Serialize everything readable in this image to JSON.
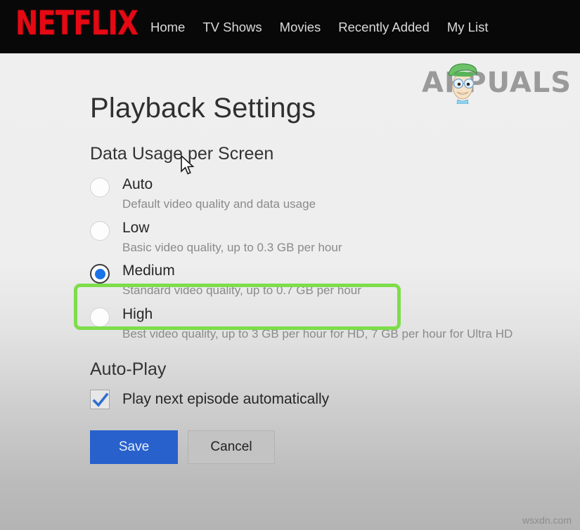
{
  "navbar": {
    "logo_text": "NETFLIX",
    "logo_color": "#e50914",
    "links": [
      {
        "label": "Home"
      },
      {
        "label": "TV Shows"
      },
      {
        "label": "Movies"
      },
      {
        "label": "Recently Added"
      },
      {
        "label": "My List"
      }
    ]
  },
  "watermarks": {
    "appuals": "APPUALS",
    "bottom_right": "wsxdn.com"
  },
  "page": {
    "title": "Playback Settings",
    "data_usage": {
      "heading": "Data Usage per Screen",
      "options": [
        {
          "label": "Auto",
          "description": "Default video quality and data usage",
          "selected": false
        },
        {
          "label": "Low",
          "description": "Basic video quality, up to 0.3 GB per hour",
          "selected": false
        },
        {
          "label": "Medium",
          "description": "Standard video quality, up to 0.7 GB per hour",
          "selected": true
        },
        {
          "label": "High",
          "description": "Best video quality, up to 3 GB per hour for HD, 7 GB per hour for Ultra HD",
          "selected": false
        }
      ]
    },
    "autoplay": {
      "heading": "Auto-Play",
      "checkbox_label": "Play next episode automatically",
      "checked": true
    },
    "buttons": {
      "save": "Save",
      "cancel": "Cancel"
    }
  },
  "annotation": {
    "highlight_color": "#7ddd4a",
    "highlighted_option": "Medium"
  },
  "accent_colors": {
    "radio_selected": "#1a73e8",
    "checkmark": "#2f6fd0",
    "save_button": "#2861cc"
  }
}
